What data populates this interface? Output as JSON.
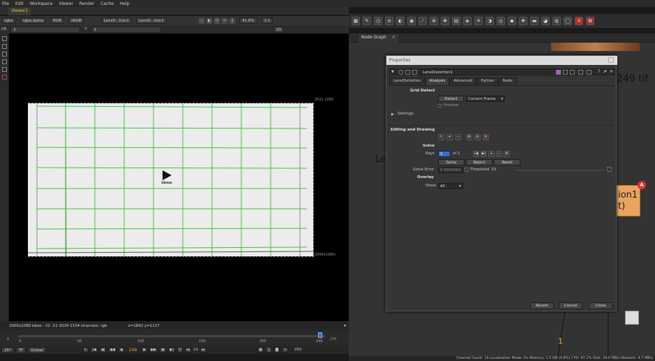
{
  "menu": [
    "File",
    "Edit",
    "Workspace",
    "Viewer",
    "Render",
    "Cache",
    "Help"
  ],
  "viewer": {
    "tab": "Viewer1",
    "channels": "rgba",
    "alpha": "rgba.alpha",
    "colorspace": "RGB",
    "lut": "sRGB",
    "input_a": "LensD...tion1",
    "input_b": "LensD...tion1",
    "fstop": "f/8",
    "gain": "1",
    "y_label": "Y",
    "gamma": "1",
    "zoom": "41.8%",
    "ratio": "1:1",
    "view_mode": "2D",
    "top_right_label": "2012,1093",
    "bottom_right_label": "(2000x1080)",
    "lens_label": "16mm",
    "status_left": "2000x1080  bbox: -22 -11 2034 1104 channels: rgb",
    "status_coords": "x=1842 y=1127"
  },
  "timeline": {
    "ticks": [
      "0",
      "50",
      "100",
      "150",
      "200",
      "249"
    ],
    "start": "0",
    "end_left": "249",
    "end_right": "250",
    "current_frame": "249",
    "fps": "25*",
    "tf": "TF",
    "global": "Global",
    "step": "10"
  },
  "node_graph": {
    "tab": "Node Graph",
    "node_label_partial": "Le",
    "tif_label": "249 tif",
    "node_orange_text": "ion1",
    "node_orange_text2": "t)",
    "badge": "A",
    "dot_label": "1"
  },
  "properties": {
    "title": "Properties",
    "node_name": "LensDistortion1",
    "tabs": [
      "LensDistortion",
      "Analysis",
      "Advanced",
      "Python",
      "Node"
    ],
    "active_tab": "Analysis",
    "grid_detect": "Grid Detect",
    "detect_btn": "Detect",
    "current_frame": "Current Frame",
    "preview": "Preview",
    "settings": "Settings",
    "editing_drawing": "Editing and Drawing",
    "solve_header": "Solve",
    "keys_label": "Keys",
    "keys_value": "1",
    "keys_of": "of 1",
    "solve_btn": "Solve",
    "reject_btn": "Reject",
    "reset_btn": "Reset",
    "solve_error_label": "Solve Error",
    "solve_error_value": "0.5665664",
    "threshold_label": "Threshold",
    "threshold_value": "10",
    "overlay_header": "Overlay",
    "show_label": "Show",
    "show_value": "All",
    "revert_btn": "Revert",
    "cancel_btn": "Cancel",
    "close_btn": "Close"
  },
  "status_bar": "Channel Count: 19  Localization Mode: On  Memory: 1.5 GB (4.8%)  CPU: 67.2%  Disk: 34.0 MB/s  Network: 4.7 MB/s",
  "colors": {
    "accent_orange": "#f0a030",
    "viewer_tab": "#f0c020",
    "grid_green": "#40c040",
    "node_orange": "#e8a560",
    "badge_red": "#e03030"
  }
}
